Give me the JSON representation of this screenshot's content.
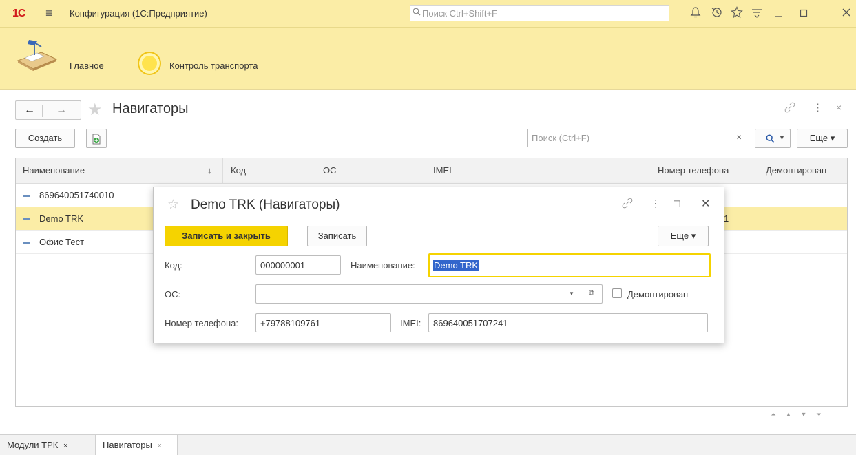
{
  "titlebar": {
    "logo": "1С",
    "app_title": "Конфигурация  (1С:Предприятие)",
    "search_placeholder": "Поиск Ctrl+Shift+F"
  },
  "sections": {
    "main_label": "Главное",
    "transport_label": "Контроль транспорта"
  },
  "form": {
    "title": "Навигаторы",
    "create_label": "Создать",
    "search_placeholder": "Поиск (Ctrl+F)",
    "more_label": "Еще ▾"
  },
  "table": {
    "columns": [
      "Наименование",
      "Код",
      "ОС",
      "IMEI",
      "Номер телефона",
      "Демонтирован"
    ],
    "sort_indicator": "↓",
    "rows": [
      {
        "name": "869640051740010",
        "selected": false
      },
      {
        "name": "Demo TRK",
        "selected": true,
        "phone_partial": "1"
      },
      {
        "name": "Офис Тест",
        "selected": false
      }
    ]
  },
  "dialog": {
    "title": "Demo TRK (Навигаторы)",
    "save_close_label": "Записать и закрыть",
    "save_label": "Записать",
    "more_label": "Еще ▾",
    "code_label": "Код:",
    "code_value": "000000001",
    "name_label": "Наименование:",
    "name_value": "Demo TRK",
    "os_label": "ОС:",
    "os_value": "",
    "dismounted_label": "Демонтирован",
    "phone_label": "Номер телефона:",
    "phone_value": "+79788109761",
    "imei_label": "IMEI:",
    "imei_value": "869640051707241"
  },
  "bottom_tabs": [
    {
      "label": "Модули ТРК",
      "close": "×"
    },
    {
      "label": "Навигаторы",
      "close": "×"
    }
  ],
  "colors": {
    "panel_yellow": "#fbeda6",
    "accent_yellow": "#f5d300",
    "selection_blue": "#3366cc"
  }
}
